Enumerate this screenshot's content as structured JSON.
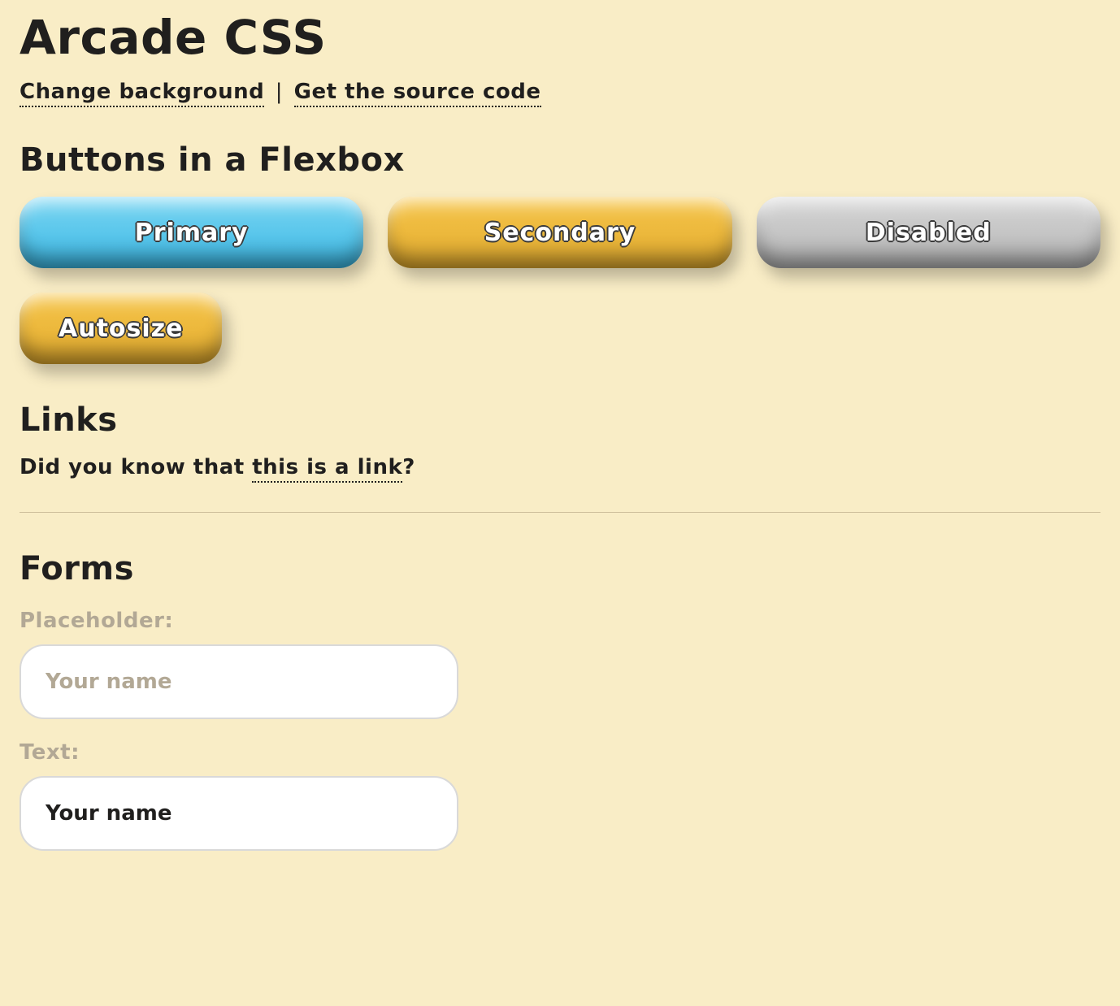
{
  "title": "Arcade CSS",
  "top_links": {
    "change_bg": "Change background",
    "separator": "|",
    "source": "Get the source code"
  },
  "sections": {
    "buttons_heading": "Buttons in a Flexbox",
    "links_heading": "Links",
    "forms_heading": "Forms"
  },
  "buttons": {
    "primary": "Primary",
    "secondary": "Secondary",
    "disabled": "Disabled",
    "autosize": "Autosize"
  },
  "links_section": {
    "prefix": "Did you know that ",
    "link": "this is a link",
    "suffix": "?"
  },
  "forms": {
    "placeholder_label": "Placeholder:",
    "placeholder_hint": "Your name",
    "text_label": "Text:",
    "text_value": "Your name"
  },
  "colors": {
    "bg": "#f9edc6",
    "blue_top": "#79d5f2",
    "blue_bot": "#3db9e5",
    "gold_top": "#f6c54a",
    "gold_bot": "#e3ac2f",
    "grey_top": "#d6d6d6",
    "grey_bot": "#b5b5b5"
  }
}
